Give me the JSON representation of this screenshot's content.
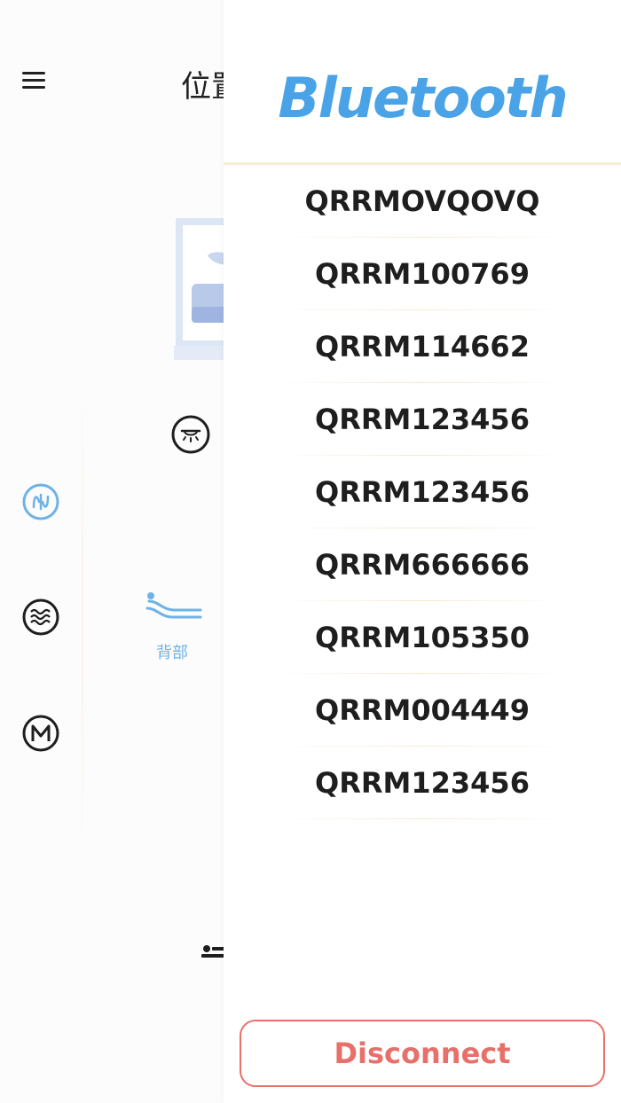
{
  "background": {
    "title": "位置",
    "back_mode_label": "背部",
    "icons": {
      "menu": "hamburger-menu-icon",
      "battery": "battery-icon",
      "rail": [
        "wave-mode-icon",
        "vibration-icon",
        "memory-icon"
      ],
      "light": "light-icon",
      "back": "back-recline-icon"
    },
    "colors": {
      "accent_blue": "#6fb2e6",
      "battery_green": "#4cd964"
    }
  },
  "drawer": {
    "title": "Bluetooth",
    "devices": [
      "QRRMOVQOVQ",
      "QRRM100769",
      "QRRM114662",
      "QRRM123456",
      "QRRM123456",
      "QRRM666666",
      "QRRM105350",
      "QRRM004449",
      "QRRM123456"
    ],
    "disconnect_label": "Disconnect",
    "colors": {
      "title": "#4aa3e6",
      "disconnect": "#e8706a",
      "divider": "#f6efd4"
    }
  }
}
